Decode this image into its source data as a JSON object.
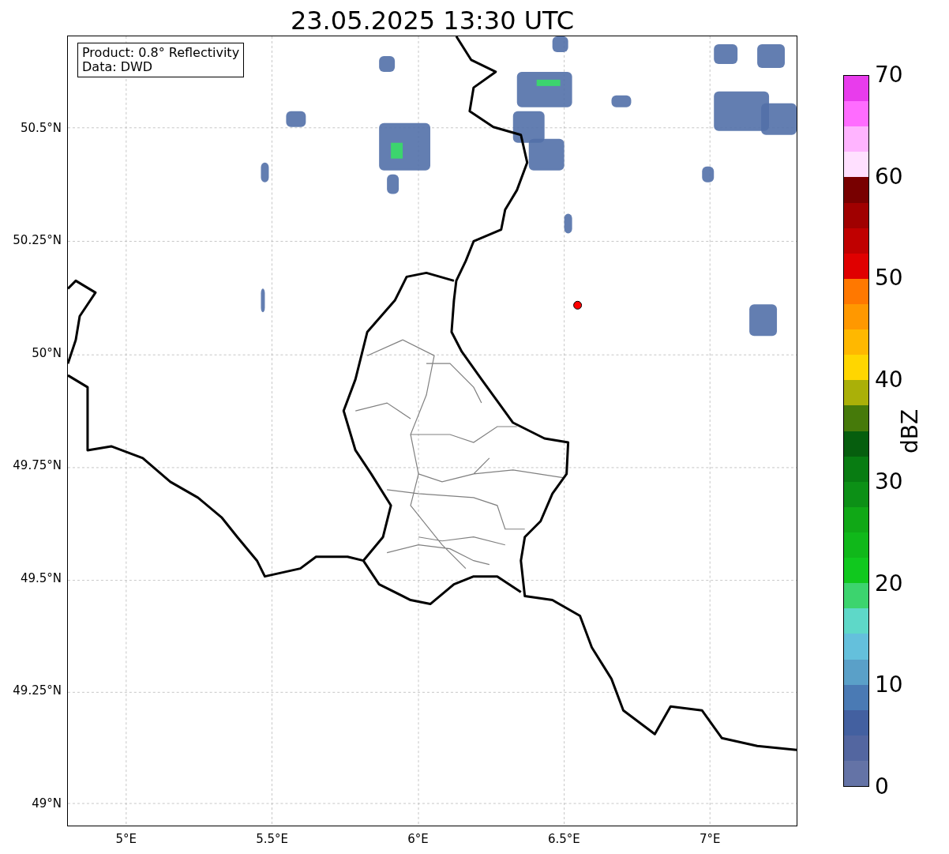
{
  "title": "23.05.2025 13:30 UTC",
  "info_box": [
    "Product: 0.8° Reflectivity",
    "Data: DWD"
  ],
  "x_ticks": [
    "5°E",
    "5.5°E",
    "6°E",
    "6.5°E",
    "7°E"
  ],
  "y_ticks": [
    "50.5°N",
    "50.25°N",
    "50°N",
    "49.75°N",
    "49.5°N",
    "49.25°N",
    "49°N"
  ],
  "colorbar": {
    "label": "dBZ",
    "ticks": [
      "70",
      "60",
      "50",
      "40",
      "30",
      "20",
      "10",
      "0"
    ],
    "bins": [
      {
        "color": "#6473a6"
      },
      {
        "color": "#5366a0"
      },
      {
        "color": "#4360a0"
      },
      {
        "color": "#4a7ab4"
      },
      {
        "color": "#5aa0c8"
      },
      {
        "color": "#64c0dc"
      },
      {
        "color": "#5ed8c8"
      },
      {
        "color": "#3cd46e"
      },
      {
        "color": "#10c81e"
      },
      {
        "color": "#10b81a"
      },
      {
        "color": "#10a816"
      },
      {
        "color": "#0c9016"
      },
      {
        "color": "#087c12"
      },
      {
        "color": "#065e0e"
      },
      {
        "color": "#467a0a"
      },
      {
        "color": "#aab008"
      },
      {
        "color": "#ffd600"
      },
      {
        "color": "#ffb800"
      },
      {
        "color": "#ff9800"
      },
      {
        "color": "#ff7800"
      },
      {
        "color": "#e00000"
      },
      {
        "color": "#c00000"
      },
      {
        "color": "#a00000"
      },
      {
        "color": "#780000"
      },
      {
        "color": "#ffe0ff"
      },
      {
        "color": "#ffb4ff"
      },
      {
        "color": "#ff6cff"
      },
      {
        "color": "#e83cec"
      }
    ]
  }
}
